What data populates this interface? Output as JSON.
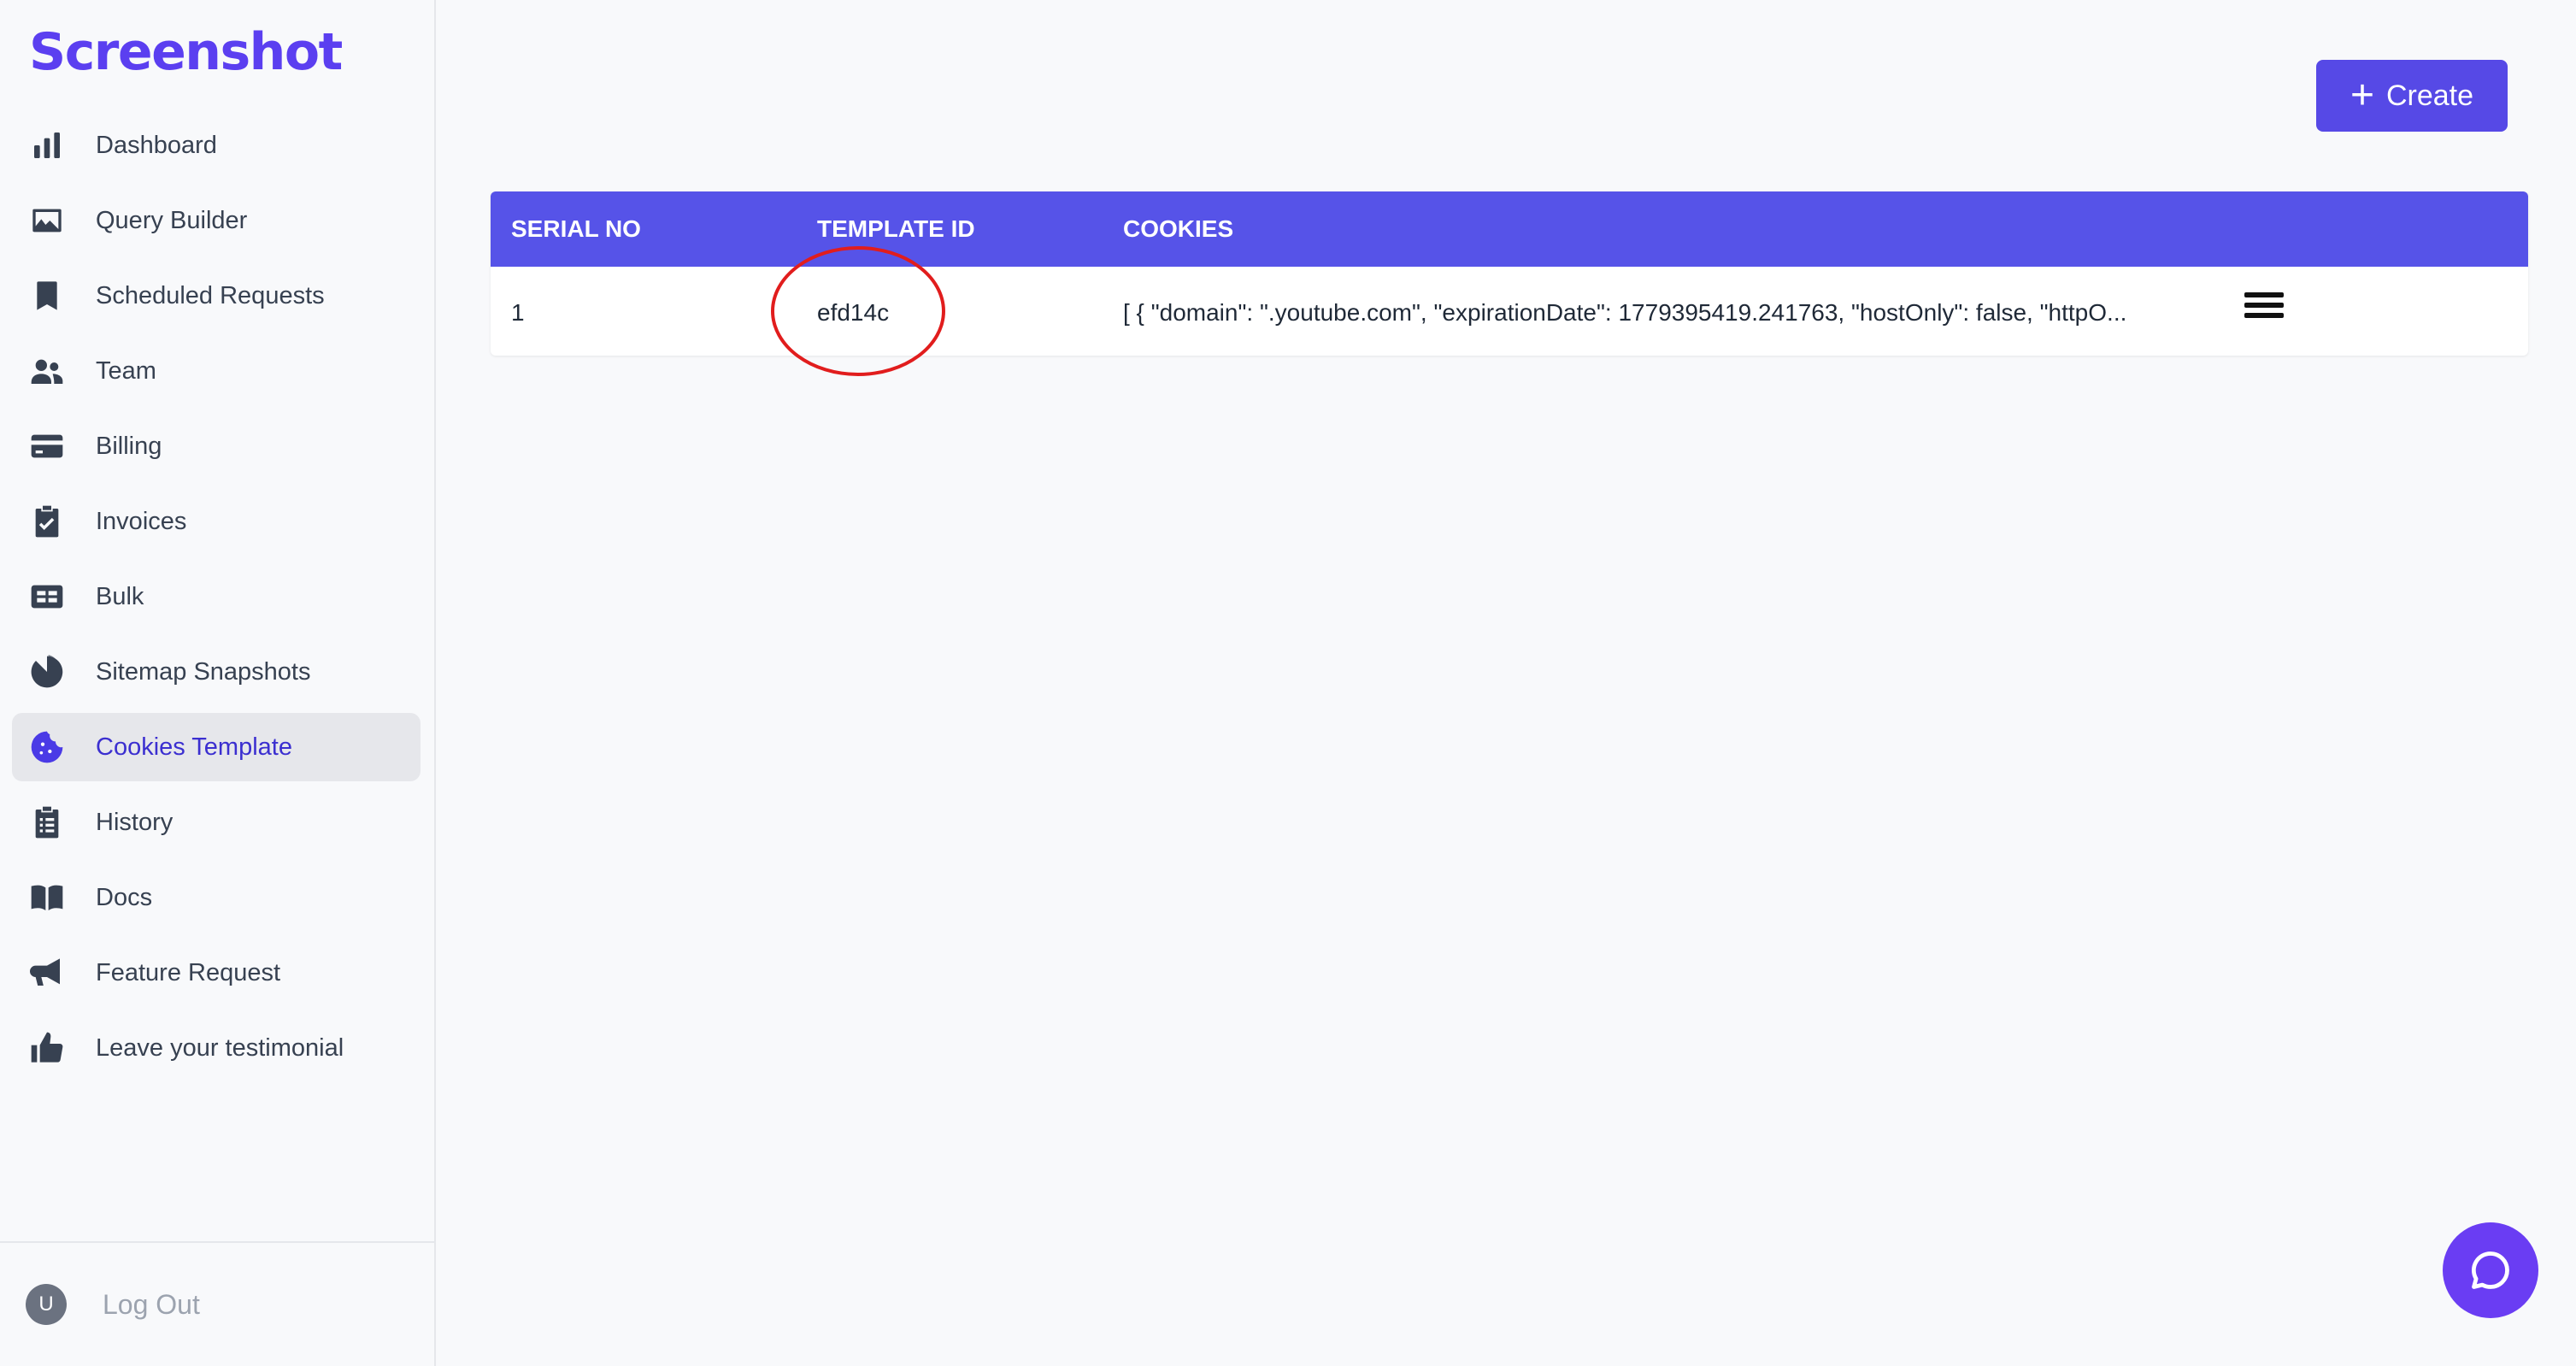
{
  "app": {
    "logo": "Screenshot"
  },
  "sidebar": {
    "items": [
      {
        "label": "Dashboard",
        "icon": "bar-chart-icon",
        "active": false
      },
      {
        "label": "Query Builder",
        "icon": "image-icon",
        "active": false
      },
      {
        "label": "Scheduled Requests",
        "icon": "bookmark-icon",
        "active": false
      },
      {
        "label": "Team",
        "icon": "users-icon",
        "active": false
      },
      {
        "label": "Billing",
        "icon": "credit-card-icon",
        "active": false
      },
      {
        "label": "Invoices",
        "icon": "clipboard-check-icon",
        "active": false
      },
      {
        "label": "Bulk",
        "icon": "table-icon",
        "active": false
      },
      {
        "label": "Sitemap Snapshots",
        "icon": "pie-icon",
        "active": false
      },
      {
        "label": "Cookies Template",
        "icon": "cookie-icon",
        "active": true
      },
      {
        "label": "History",
        "icon": "clipboard-list-icon",
        "active": false
      },
      {
        "label": "Docs",
        "icon": "book-icon",
        "active": false
      },
      {
        "label": "Feature Request",
        "icon": "megaphone-icon",
        "active": false
      },
      {
        "label": "Leave your testimonial",
        "icon": "thumbs-up-icon",
        "active": false
      }
    ],
    "user_initial": "U",
    "logout_label": "Log Out"
  },
  "toolbar": {
    "create_label": "Create",
    "create_icon": "plus-icon"
  },
  "table": {
    "columns": [
      "SERIAL NO",
      "TEMPLATE ID",
      "COOKIES"
    ],
    "rows": [
      {
        "serial": "1",
        "template_id": "efd14c",
        "cookies": "[ { \"domain\": \".youtube.com\", \"expirationDate\": 1779395419.241763, \"hostOnly\": false, \"httpO..."
      }
    ]
  },
  "colors": {
    "accent": "#5649e6",
    "header": "#5653e8",
    "active_bg": "#e6e7eb",
    "annotation": "#e11d1d"
  },
  "chat": {
    "icon": "chat-bubble-icon"
  }
}
